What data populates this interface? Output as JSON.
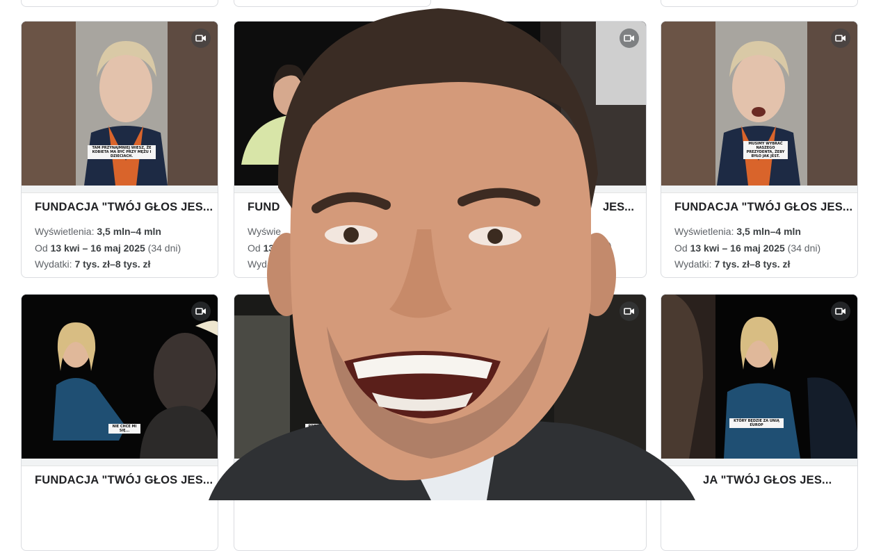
{
  "cards": [
    {
      "title": "FUNDACJA \"TWÓJ GŁOS JES...",
      "views_label": "Wyświetlenia: ",
      "views_value": "3,5 mln–4 mln",
      "date_prefix": "Od ",
      "date_value": "13 kwi – 16 maj 2025",
      "date_suffix": " (34 dni)",
      "spend_label": "Wydatki: ",
      "spend_value": "7 tys. zł–8 tys. zł",
      "caption": "TAM PRZYNAJMNIEJ WIESZ, ŻE KOBIETA MA BYĆ PRZY MĘŻU I DZIECIACH."
    },
    {
      "title": "FUNDACJA \"TWÓJ GŁOS JES...",
      "views_label": "Wyświe",
      "date_prefix": "Od ",
      "date_value": "13",
      "spend_label": "Wydat",
      "title_left": "FUND",
      "title_right": "JES...",
      "date_right": "i)"
    },
    {
      "title": "FUNDACJA \"TWÓJ GŁOS JES...",
      "views_label": "Wyświetlenia: ",
      "views_value": "3,5 mln–4 mln",
      "date_prefix": "Od ",
      "date_value": "13 kwi – 16 maj 2025",
      "date_suffix": " (34 dni)",
      "spend_label": "Wydatki: ",
      "spend_value": "7 tys. zł–8 tys. zł",
      "caption": "MUSIMY WYBRAĆ NASZEGO PREZYDENTA, ŻEBY BYŁO JAK JEST."
    },
    {
      "title": "FUNDACJA \"TWÓJ GŁOS JES...",
      "caption": "NIE CHCE MI SIĘ..."
    },
    {
      "caption": "PRZ"
    },
    {
      "title": "JA \"TWÓJ GŁOS JES...",
      "caption": "KTÓRY BĘDZIE ZA UNIĄ EUROP"
    }
  ],
  "icon": "video-camera-icon"
}
